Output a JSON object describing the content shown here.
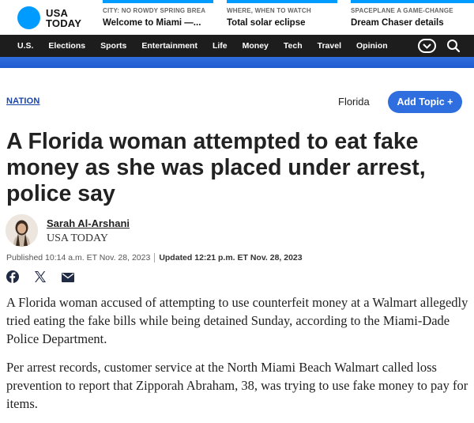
{
  "header": {
    "logo_line1": "USA",
    "logo_line2": "TODAY",
    "promos": [
      {
        "kicker": "CITY: NO ROWDY SPRING BREA",
        "headline": "Welcome to Miami —..."
      },
      {
        "kicker": "WHERE, WHEN TO WATCH",
        "headline": "Total solar eclipse"
      },
      {
        "kicker": "SPACEPLANE A GAME-CHANGE",
        "headline": "Dream Chaser details"
      }
    ]
  },
  "nav": {
    "items": [
      "U.S.",
      "Elections",
      "Sports",
      "Entertainment",
      "Life",
      "Money",
      "Tech",
      "Travel",
      "Opinion"
    ],
    "more_icon": "chevron-down-icon",
    "search_icon": "search-icon"
  },
  "section": {
    "label": "NATION",
    "topic": "Florida",
    "add_topic": "Add Topic +"
  },
  "article": {
    "headline": "A Florida woman attempted to eat fake money as she was placed under arrest, police say",
    "author": "Sarah Al-Arshani",
    "org": "USA TODAY",
    "published": "Published 10:14 a.m. ET Nov. 28, 2023",
    "updated": "Updated 12:21 p.m. ET Nov. 28, 2023",
    "share_icons": [
      "facebook-icon",
      "x-icon",
      "email-icon"
    ],
    "paragraphs": [
      "A Florida woman accused of attempting to use counterfeit money at a Walmart allegedly tried eating the fake bills while being detained Sunday, according to the Miami-Dade Police Department.",
      "Per arrest records, customer service at the North Miami Beach Walmart called loss prevention to report that Zipporah Abraham, 38, was trying to use fake money to pay for items."
    ]
  },
  "colors": {
    "brand_blue": "#009bff",
    "nav_bg": "#1d1d1d",
    "accent_blue": "#2f6ede",
    "link_blue": "#1a45a6"
  }
}
